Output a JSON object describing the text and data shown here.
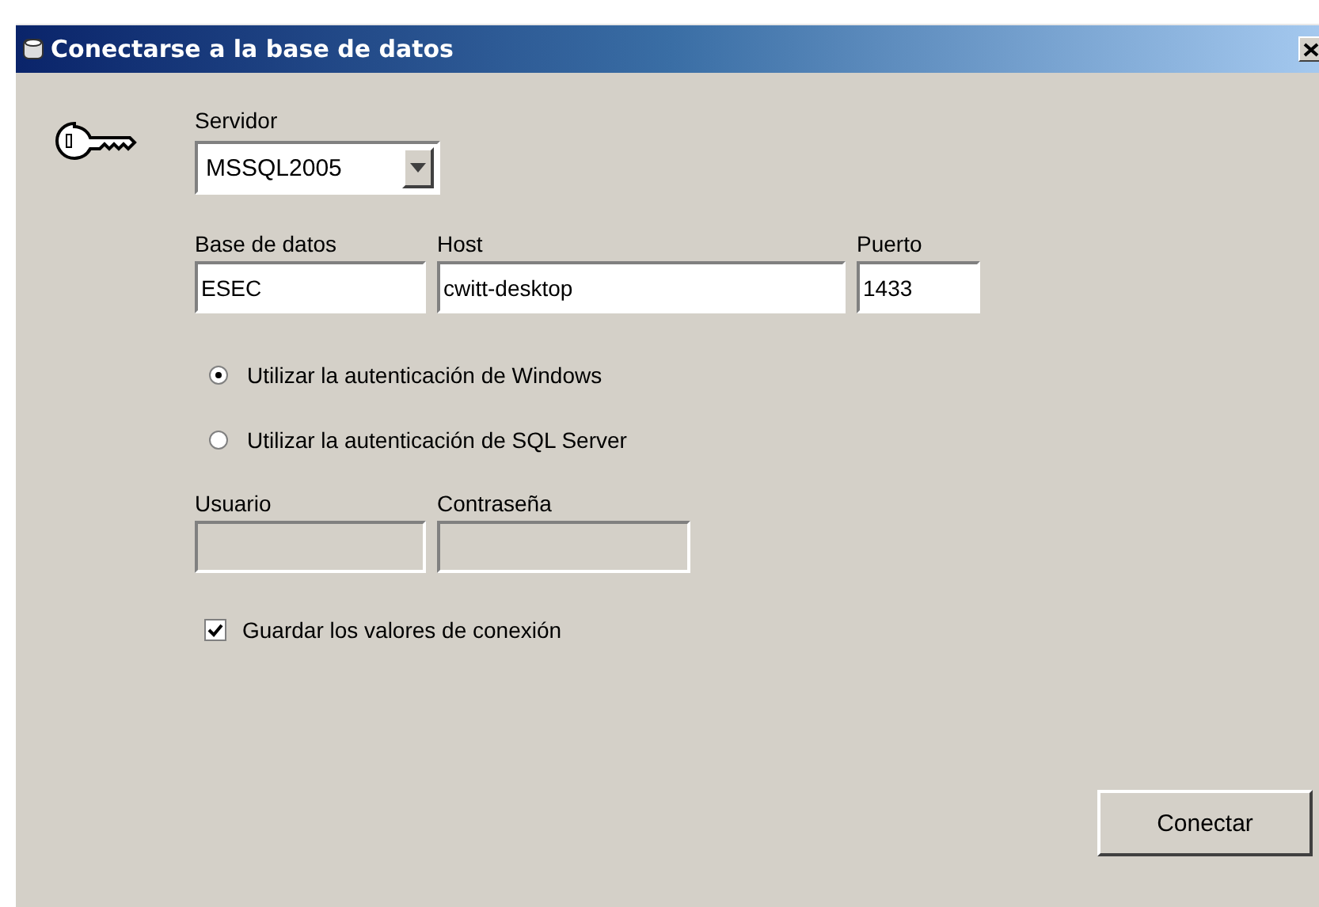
{
  "window": {
    "title": "Conectarse a la base de datos"
  },
  "server": {
    "label": "Servidor",
    "value": "MSSQL2005"
  },
  "connection_fields": [
    {
      "label": "Base de datos",
      "value": "ESEC",
      "disabled": false
    },
    {
      "label": "Host",
      "value": "cwitt-desktop",
      "disabled": false
    },
    {
      "label": "Puerto",
      "value": "1433",
      "disabled": false
    }
  ],
  "auth_options": [
    {
      "label": "Utilizar la autenticación de Windows",
      "selected": true
    },
    {
      "label": "Utilizar la autenticación de SQL Server",
      "selected": false
    }
  ],
  "credential_fields": [
    {
      "label": "Usuario",
      "disabled": true
    },
    {
      "label": "Contraseña",
      "disabled": true
    }
  ],
  "save_values": {
    "label": "Guardar los valores de conexión",
    "checked": true
  },
  "buttons": [
    {
      "label": "Conectar"
    }
  ]
}
